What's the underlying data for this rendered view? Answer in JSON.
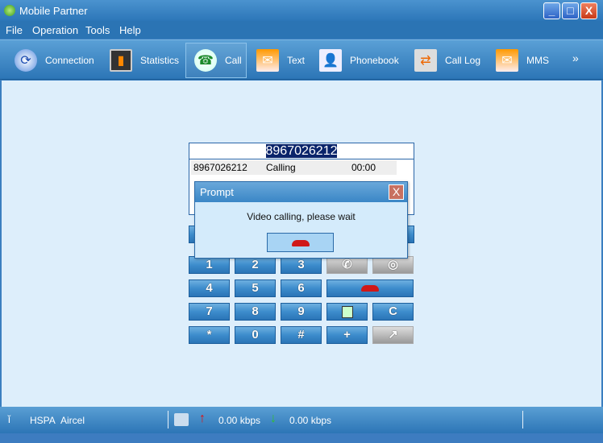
{
  "window": {
    "title": "Mobile Partner",
    "minimize": "_",
    "maximize": "□",
    "close": "X"
  },
  "menu": [
    "File",
    "Operation",
    "Tools",
    "Help"
  ],
  "toolbar": {
    "items": [
      {
        "label": "Connection",
        "icon": "connection-icon"
      },
      {
        "label": "Statistics",
        "icon": "statistics-icon"
      },
      {
        "label": "Call",
        "icon": "call-icon",
        "selected": true
      },
      {
        "label": "Text",
        "icon": "text-icon"
      },
      {
        "label": "Phonebook",
        "icon": "phonebook-icon"
      },
      {
        "label": "Call Log",
        "icon": "call-log-icon"
      },
      {
        "label": "MMS",
        "icon": "mms-icon"
      }
    ],
    "more": "»"
  },
  "call": {
    "number_input": "8967026212",
    "log": {
      "number": "8967026212",
      "status": "Calling",
      "duration": "00:00"
    }
  },
  "keypad": {
    "keys": [
      "1",
      "2",
      "3",
      "4",
      "5",
      "6",
      "7",
      "8",
      "9",
      "*",
      "0",
      "#",
      "+",
      "C"
    ]
  },
  "dialog": {
    "title": "Prompt",
    "close": "X",
    "message": "Video calling, please wait"
  },
  "status": {
    "network": "HSPA",
    "operator": "Aircel",
    "upload": "0.00 kbps",
    "download": "0.00 kbps"
  },
  "colors": {
    "accent": "#2c75b6",
    "content_bg": "#ddeefb",
    "hangup": "#d01818"
  }
}
